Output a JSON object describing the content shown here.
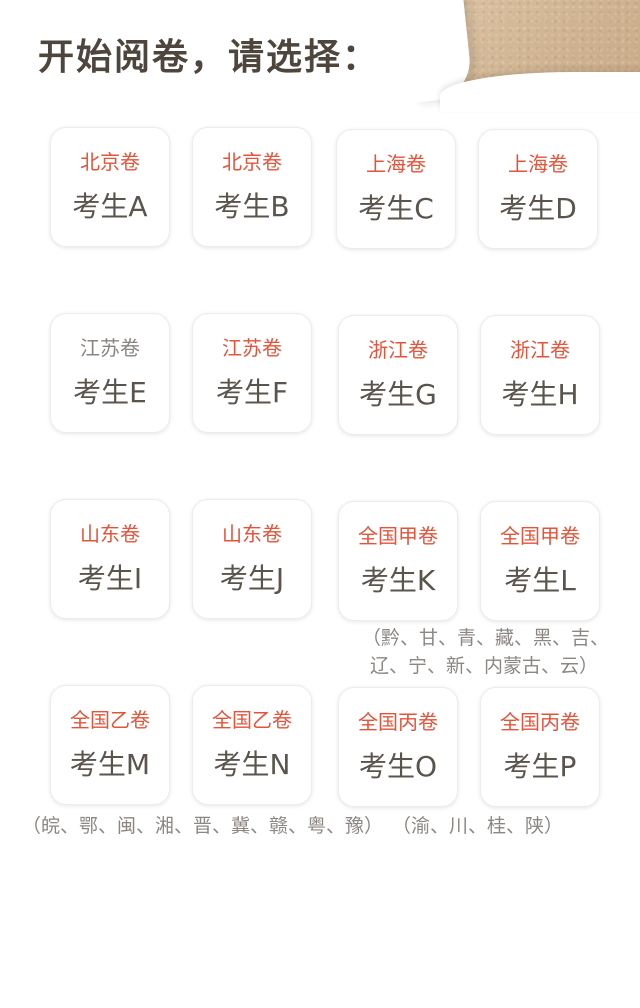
{
  "header": {
    "title": "开始阅卷，请选择："
  },
  "cards": [
    {
      "region": "北京卷",
      "candidate": "考生A"
    },
    {
      "region": "北京卷",
      "candidate": "考生B"
    },
    {
      "region": "上海卷",
      "candidate": "考生C"
    },
    {
      "region": "上海卷",
      "candidate": "考生D"
    },
    {
      "region": "江苏卷",
      "candidate": "考生E"
    },
    {
      "region": "江苏卷",
      "candidate": "考生F"
    },
    {
      "region": "浙江卷",
      "candidate": "考生G"
    },
    {
      "region": "浙江卷",
      "candidate": "考生H"
    },
    {
      "region": "山东卷",
      "candidate": "考生I"
    },
    {
      "region": "山东卷",
      "candidate": "考生J"
    },
    {
      "region": "全国甲卷",
      "candidate": "考生K"
    },
    {
      "region": "全国甲卷",
      "candidate": "考生L"
    },
    {
      "region": "全国乙卷",
      "candidate": "考生M"
    },
    {
      "region": "全国乙卷",
      "candidate": "考生N"
    },
    {
      "region": "全国丙卷",
      "candidate": "考生O"
    },
    {
      "region": "全国丙卷",
      "candidate": "考生P"
    }
  ],
  "notes": {
    "jia_line1": "（黔、甘、青、藏、黑、吉、",
    "jia_line2": "辽、宁、新、内蒙古、云）",
    "yi": "（皖、鄂、闽、湘、晋、冀、赣、粤、豫）",
    "bing": "（渝、川、桂、陕）"
  },
  "colors": {
    "accent": "#e4533a",
    "muted": "#8a8580",
    "text": "#5b544d",
    "title": "#4e453c",
    "paper": "#d4b896"
  }
}
